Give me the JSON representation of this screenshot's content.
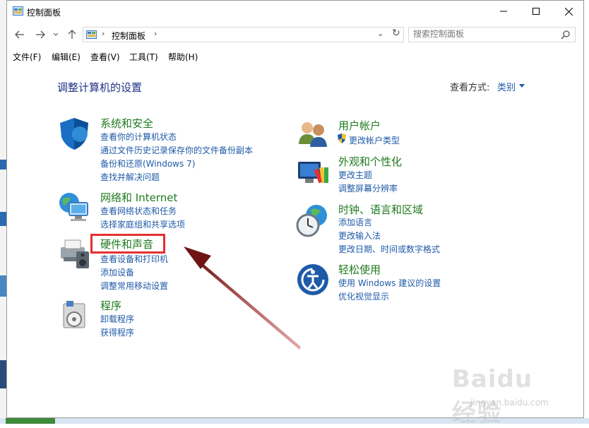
{
  "window": {
    "title": "控制面板"
  },
  "nav": {
    "address_crumb": "控制面板",
    "search_placeholder": "搜索控制面板"
  },
  "menu": [
    "文件(F)",
    "编辑(E)",
    "查看(V)",
    "工具(T)",
    "帮助(H)"
  ],
  "content": {
    "title": "调整计算机的设置",
    "view_by_label": "查看方式:",
    "view_by_value": "类别"
  },
  "categories": {
    "system": {
      "title": "系统和安全",
      "links": [
        "查看你的计算机状态",
        "通过文件历史记录保存你的文件备份副本",
        "备份和还原(Windows 7)",
        "查找并解决问题"
      ]
    },
    "network": {
      "title": "网络和 Internet",
      "links": [
        "查看网络状态和任务",
        "选择家庭组和共享选项"
      ]
    },
    "hardware": {
      "title": "硬件和声音",
      "links": [
        "查看设备和打印机",
        "添加设备",
        "调整常用移动设置"
      ]
    },
    "programs": {
      "title": "程序",
      "links": [
        "卸载程序",
        "获得程序"
      ]
    },
    "user": {
      "title": "用户帐户",
      "links": [
        "更改帐户类型"
      ]
    },
    "appearance": {
      "title": "外观和个性化",
      "links": [
        "更改主题",
        "调整屏幕分辨率"
      ]
    },
    "clock": {
      "title": "时钟、语言和区域",
      "links": [
        "添加语言",
        "更改输入法",
        "更改日期、时间或数字格式"
      ]
    },
    "ease": {
      "title": "轻松使用",
      "links": [
        "使用 Windows 建议的设置",
        "优化视觉显示"
      ]
    }
  },
  "watermark": {
    "brand": "Baidu 经验",
    "url": "jingyan.baidu.com"
  },
  "colors": {
    "highlight": "#e53030",
    "arrow": "#7a1a1a",
    "link": "#1e5aa8",
    "category": "#1e7a1e"
  }
}
